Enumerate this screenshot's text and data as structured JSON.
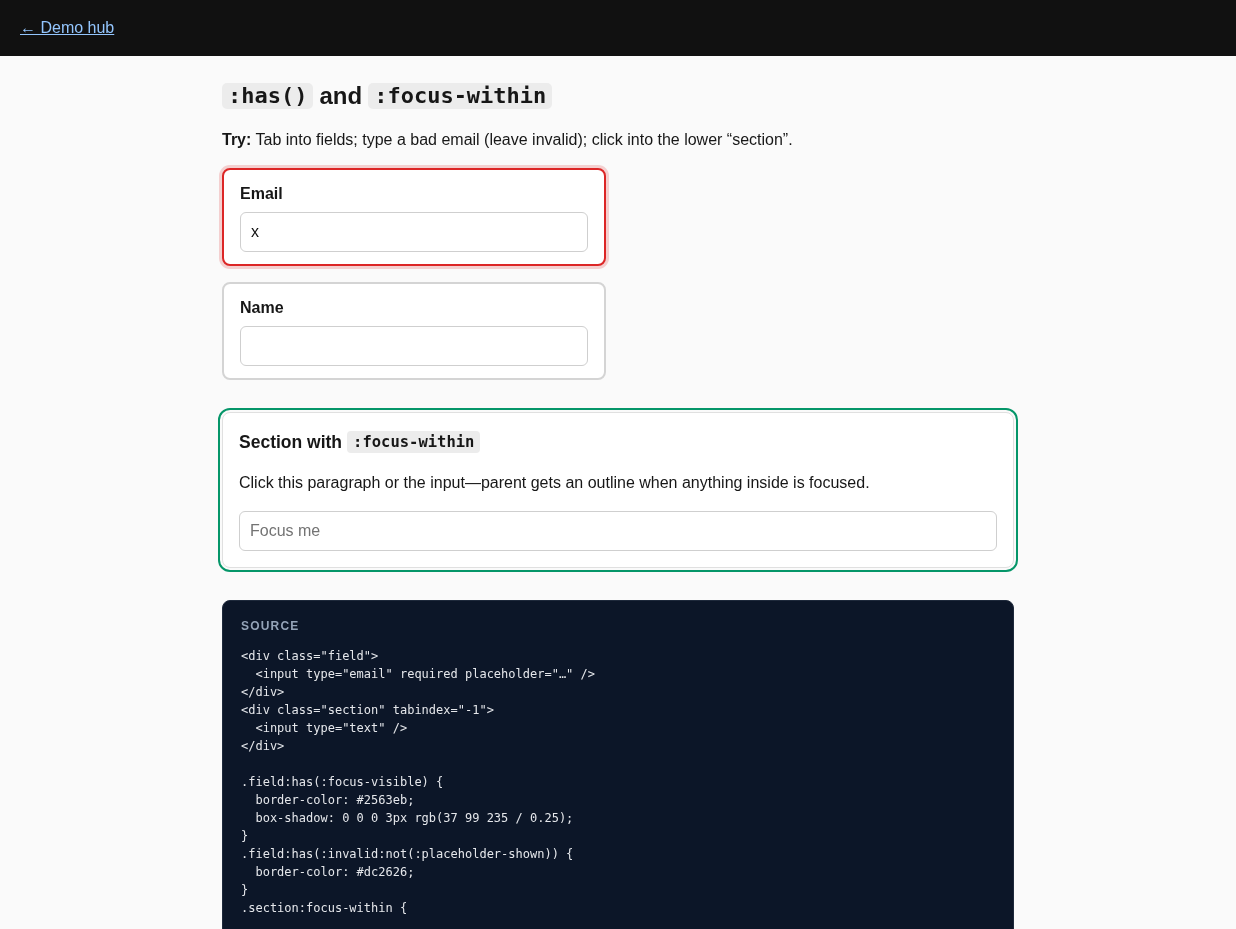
{
  "nav": {
    "back_link": "← Demo hub"
  },
  "title": [
    {
      "kind": "code",
      "text": ":has()"
    },
    {
      "kind": "text",
      "text": "and"
    },
    {
      "kind": "code",
      "text": ":focus-within"
    }
  ],
  "intro": "**Try:** Tab into fields; type a bad email (leave invalid); click into the lower “section”.",
  "fields": [
    {
      "label": "Email",
      "value": "x",
      "invalid": true
    },
    {
      "label": "Name",
      "invalid": false
    }
  ],
  "section": {
    "focused": true,
    "heading": [
      {
        "kind": "text",
        "text": "Section with"
      },
      {
        "kind": "code",
        "text": ":focus-within"
      }
    ],
    "description": "Click this paragraph or the input—parent gets an outline when anything inside is focused.",
    "input": {
      "placeholder": "Focus me"
    }
  },
  "source": {
    "label": "SOURCE",
    "code": "<div class=\"field\">\n  <input type=\"email\" required placeholder=\"…\" />\n</div>\n<div class=\"section\" tabindex=\"-1\">\n  <input type=\"text\" />\n</div>\n\n.field:has(:focus-visible) {\n  border-color: #2563eb;\n  box-shadow: 0 0 0 3px rgb(37 99 235 / 0.25);\n}\n.field:has(:invalid:not(:placeholder-shown)) {\n  border-color: #dc2626;\n}\n.section:focus-within {"
  }
}
